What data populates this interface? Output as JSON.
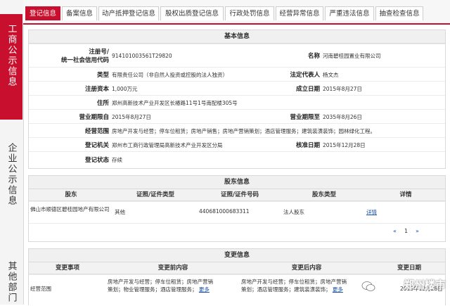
{
  "rail": {
    "items": [
      {
        "label": "工商公示信息"
      },
      {
        "label": "企业公示信息"
      },
      {
        "label": "其他部门"
      }
    ]
  },
  "tabs": [
    {
      "label": "登记信息"
    },
    {
      "label": "备案信息"
    },
    {
      "label": "动产抵押登记信息"
    },
    {
      "label": "股权出质登记信息"
    },
    {
      "label": "行政处罚信息"
    },
    {
      "label": "经营异常信息"
    },
    {
      "label": "严重违法信息"
    },
    {
      "label": "抽查检查信息"
    }
  ],
  "basic": {
    "title": "基本信息",
    "reg_no_label_1": "注册号/",
    "reg_no_label_2": "统一社会信用代码",
    "reg_no": "914101003561T29820",
    "name_label": "名称",
    "name": "河南碧桂园置业有限公司",
    "type_label": "类型",
    "type": "有限责任公司（非自然人投资或控股的法人独资）",
    "legal_rep_label": "法定代表人",
    "legal_rep": "杨文杰",
    "capital_label": "注册资本",
    "capital": "1,000万元",
    "established_label": "成立日期",
    "established": "2015年8月27日",
    "address_label": "住所",
    "address": "郑州高新技术产业开发区长椿路11号1号南配楼305号",
    "term_from_label": "营业期限自",
    "term_from": "2015年8月27日",
    "term_to_label": "营业期限至",
    "term_to": "2035年8月26日",
    "scope_label": "经营范围",
    "scope": "房地产开发与经营；停车位租赁；房地产销售；房地产营销策划；酒店管理服务；建筑装潢装饰；园林绿化工程。",
    "authority_label": "登记机关",
    "authority": "郑州市工商行政管理局高新技术产业开发区分局",
    "approval_label": "核准日期",
    "approval": "2015年12月28日",
    "status_label": "登记状态",
    "status": "存续"
  },
  "shareholders": {
    "title": "股东信息",
    "headers": [
      "股东",
      "证照/证件类型",
      "证照/证件号码",
      "股东类型",
      "详情"
    ],
    "rows": [
      {
        "name": "佛山市顺德区碧桂园地产有限公司",
        "id_type": "其他",
        "id_no": "440681000683311",
        "holder_type": "法人股东",
        "detail": "详情"
      }
    ],
    "pager": {
      "prev": "«",
      "page": "1",
      "next": "»"
    }
  },
  "changes": {
    "title": "变更信息",
    "headers": [
      "变更事项",
      "变更前内容",
      "变更后内容",
      "变更日期"
    ],
    "rows": [
      {
        "item": "经营范围",
        "before": "房地产开发与经营；停车位租赁；房地产营销策划；物业管理服务；酒店管理服务；",
        "before_more": "更多",
        "after": "房地产开发与经营；停车位租赁；房地产营销策划；酒店管理服务；建筑装潢装饰；",
        "after_more": "更多",
        "date": "2015年12月28日"
      }
    ]
  },
  "watermark": {
    "text": "郑州楼市"
  },
  "colors": {
    "accent": "#c8102e",
    "link": "#1a4fa3"
  }
}
